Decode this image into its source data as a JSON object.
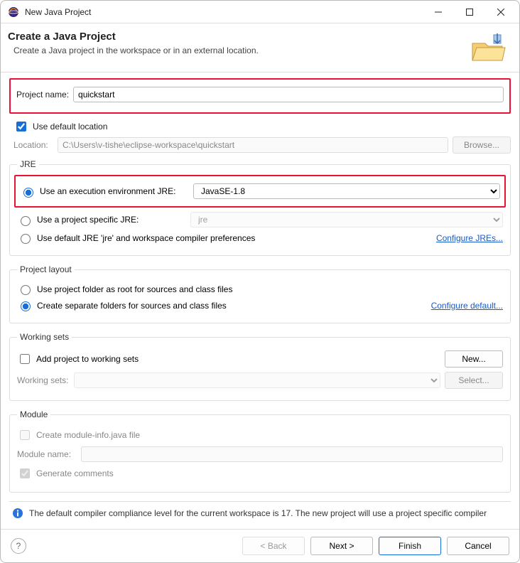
{
  "window": {
    "title": "New Java Project"
  },
  "header": {
    "title": "Create a Java Project",
    "subtitle": "Create a Java project in the workspace or in an external location."
  },
  "projectName": {
    "label": "Project name:",
    "value": "quickstart"
  },
  "location": {
    "useDefaultLabel": "Use default location",
    "useDefaultChecked": true,
    "locationLabel": "Location:",
    "locationValue": "C:\\Users\\v-tishe\\eclipse-workspace\\quickstart",
    "browseLabel": "Browse..."
  },
  "jre": {
    "legend": "JRE",
    "useEnvLabel": "Use an execution environment JRE:",
    "useEnvValue": "JavaSE-1.8",
    "useProjectLabel": "Use a project specific JRE:",
    "useProjectValue": "jre",
    "useDefaultLabel": "Use default JRE 'jre' and workspace compiler preferences",
    "configureLink": "Configure JREs..."
  },
  "projectLayout": {
    "legend": "Project layout",
    "useRootLabel": "Use project folder as root for sources and class files",
    "separateLabel": "Create separate folders for sources and class files",
    "configureLink": "Configure default..."
  },
  "workingSets": {
    "legend": "Working sets",
    "addLabel": "Add project to working sets",
    "newLabel": "New...",
    "workingSetsLabel": "Working sets:",
    "selectLabel": "Select..."
  },
  "module": {
    "legend": "Module",
    "createInfoLabel": "Create module-info.java file",
    "moduleNameLabel": "Module name:",
    "generateCommentsLabel": "Generate comments"
  },
  "info": {
    "text": "The default compiler compliance level for the current workspace is 17. The new project will use a project specific compiler"
  },
  "footer": {
    "back": "< Back",
    "next": "Next >",
    "finish": "Finish",
    "cancel": "Cancel"
  }
}
